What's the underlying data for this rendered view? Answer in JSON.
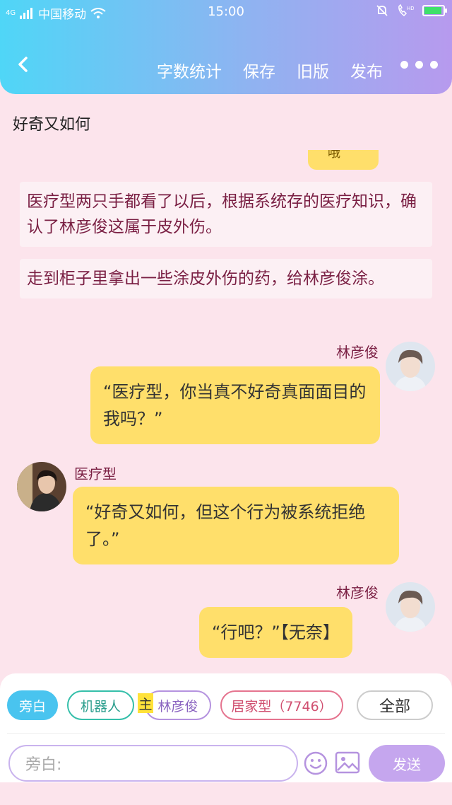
{
  "status_bar": {
    "carrier": "中国移动",
    "network": "4G",
    "time": "15:00"
  },
  "nav": {
    "items": [
      "字数统计",
      "保存",
      "旧版",
      "发布"
    ]
  },
  "doc_title": "好奇又如何",
  "chat": {
    "partial_text": "哦",
    "narrations": [
      "医疗型两只手都看了以后，根据系统存的医疗知识，确认了林彦俊这属于皮外伤。",
      "走到柜子里拿出一些涂皮外伤的药，给林彦俊涂。"
    ],
    "messages": [
      {
        "speaker": "林彦俊",
        "text": "“医疗型，你当真不好奇真面面目的我吗？”"
      },
      {
        "speaker": "医疗型",
        "text": "“好奇又如何，但这个行为被系统拒绝了。”"
      },
      {
        "speaker": "林彦俊",
        "text": "“行吧？”【无奈】"
      }
    ]
  },
  "chips": {
    "narration": "旁白",
    "robot": "机器人",
    "main_tag": "主",
    "lin": "林彦俊",
    "home": "居家型（7746）",
    "all": "全部"
  },
  "input": {
    "placeholder": "旁白:",
    "send_label": "发送"
  },
  "colors": {
    "header_start": "#4fd6f7",
    "header_end": "#b79aee",
    "background": "#fce4ec",
    "bubble": "#ffdf6b",
    "narration_text": "#7a1f43",
    "send_button": "#c5a6ee"
  }
}
